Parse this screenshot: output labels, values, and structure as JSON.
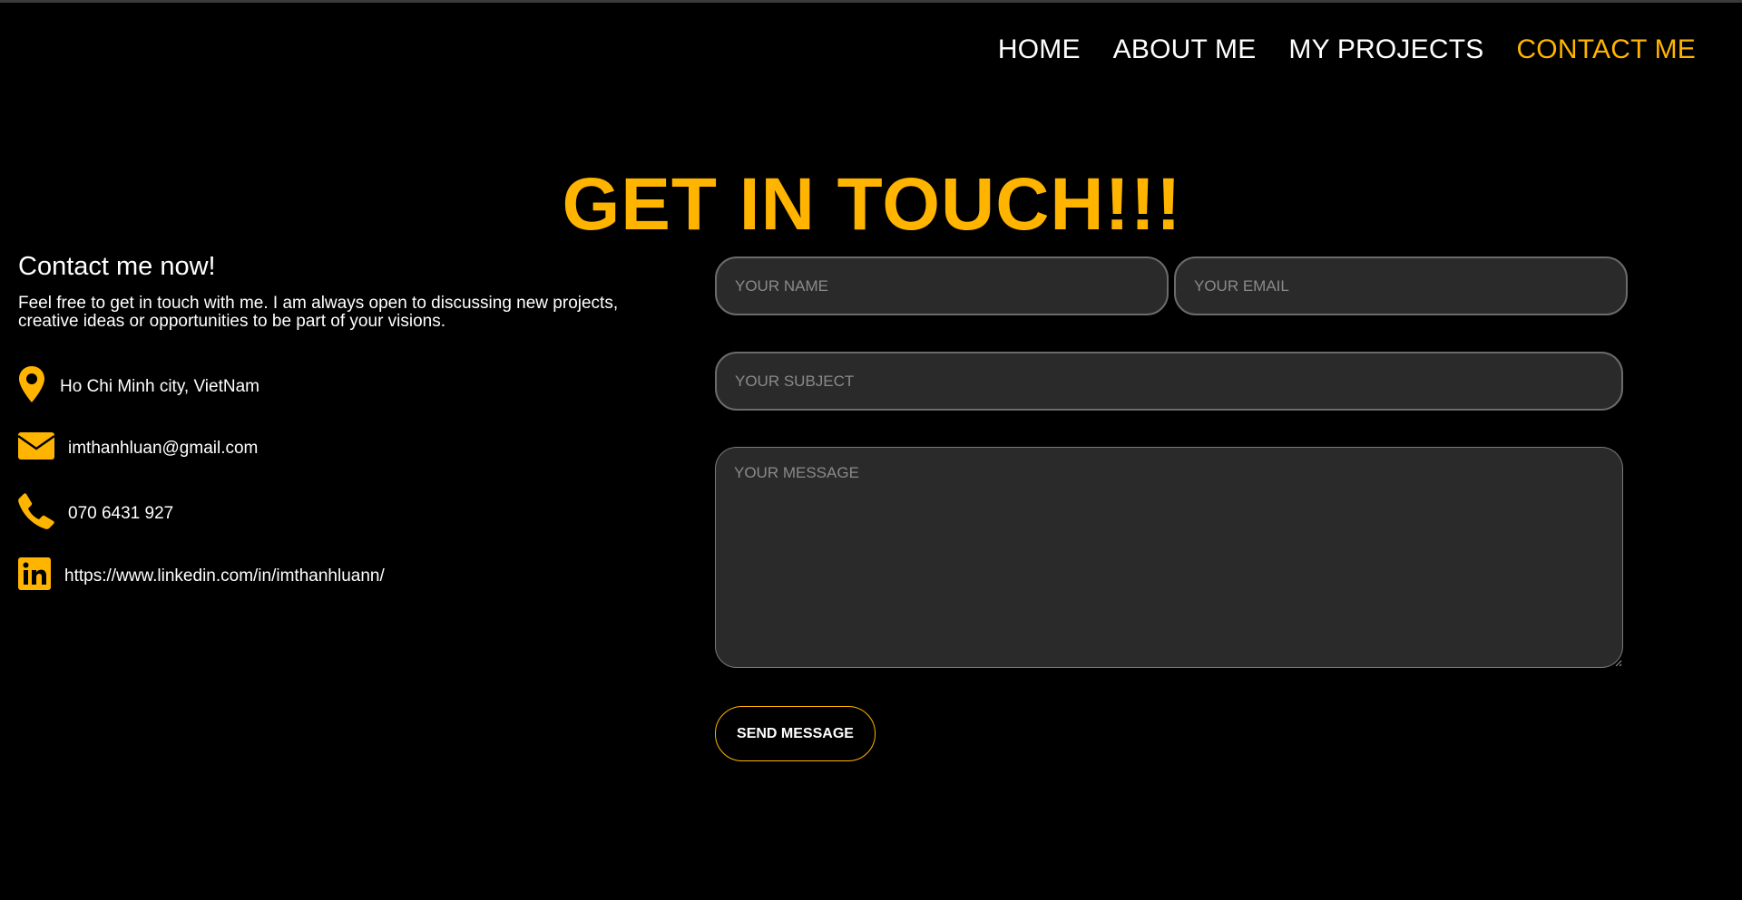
{
  "nav": {
    "items": [
      {
        "label": "HOME"
      },
      {
        "label": "ABOUT ME"
      },
      {
        "label": "MY PROJECTS"
      },
      {
        "label": "CONTACT ME"
      }
    ],
    "active": "CONTACT ME"
  },
  "page_title": "GET IN TOUCH!!!",
  "contact": {
    "heading": "Contact me now!",
    "description": "Feel free to get in touch with me. I am always open to discussing new projects, creative ideas or opportunities to be part of your visions.",
    "location": "Ho Chi Minh city, VietNam",
    "email": "imthanhluan@gmail.com",
    "phone": "070 6431 927",
    "linkedin": "https://www.linkedin.com/in/imthanhluann/"
  },
  "form": {
    "name_placeholder": "YOUR NAME",
    "email_placeholder": "YOUR EMAIL",
    "subject_placeholder": "YOUR SUBJECT",
    "message_placeholder": "YOUR MESSAGE",
    "submit_label": "SEND MESSAGE"
  },
  "colors": {
    "accent": "#FFB400",
    "background": "#000000",
    "field_background": "#2a2a2a"
  },
  "icons": [
    "map-pin-icon",
    "envelope-icon",
    "phone-icon",
    "linkedin-icon"
  ]
}
